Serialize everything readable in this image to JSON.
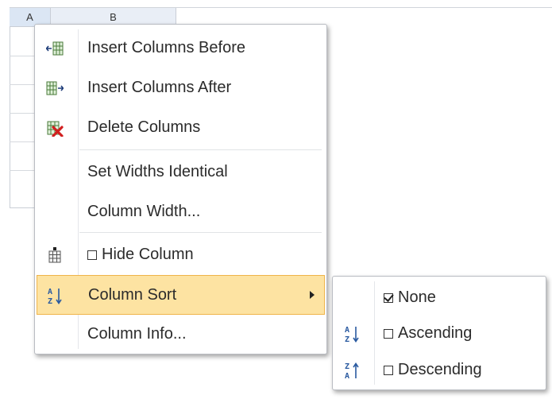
{
  "sheet": {
    "columns": [
      "A",
      "B"
    ]
  },
  "context_menu": {
    "items": [
      {
        "label": "Insert Columns Before",
        "icon": "insert-columns-before-icon"
      },
      {
        "label": "Insert Columns After",
        "icon": "insert-columns-after-icon"
      },
      {
        "label": "Delete Columns",
        "icon": "delete-columns-icon"
      },
      {
        "label": "Set Widths Identical"
      },
      {
        "label": "Column Width..."
      },
      {
        "label": "Hide Column",
        "icon": "hide-column-icon",
        "checked": false
      },
      {
        "label": "Column Sort",
        "icon": "sort-icon",
        "highlighted": true,
        "has_submenu": true
      },
      {
        "label": "Column Info..."
      }
    ]
  },
  "sort_submenu": {
    "items": [
      {
        "label": "None",
        "checked": true
      },
      {
        "label": "Ascending",
        "icon": "sort-ascending-icon",
        "checked": false
      },
      {
        "label": "Descending",
        "icon": "sort-descending-icon",
        "checked": false
      }
    ]
  },
  "colors": {
    "highlight": "#fde3a2",
    "highlight_border": "#efb44a",
    "header_bg": "#e9eef6"
  }
}
